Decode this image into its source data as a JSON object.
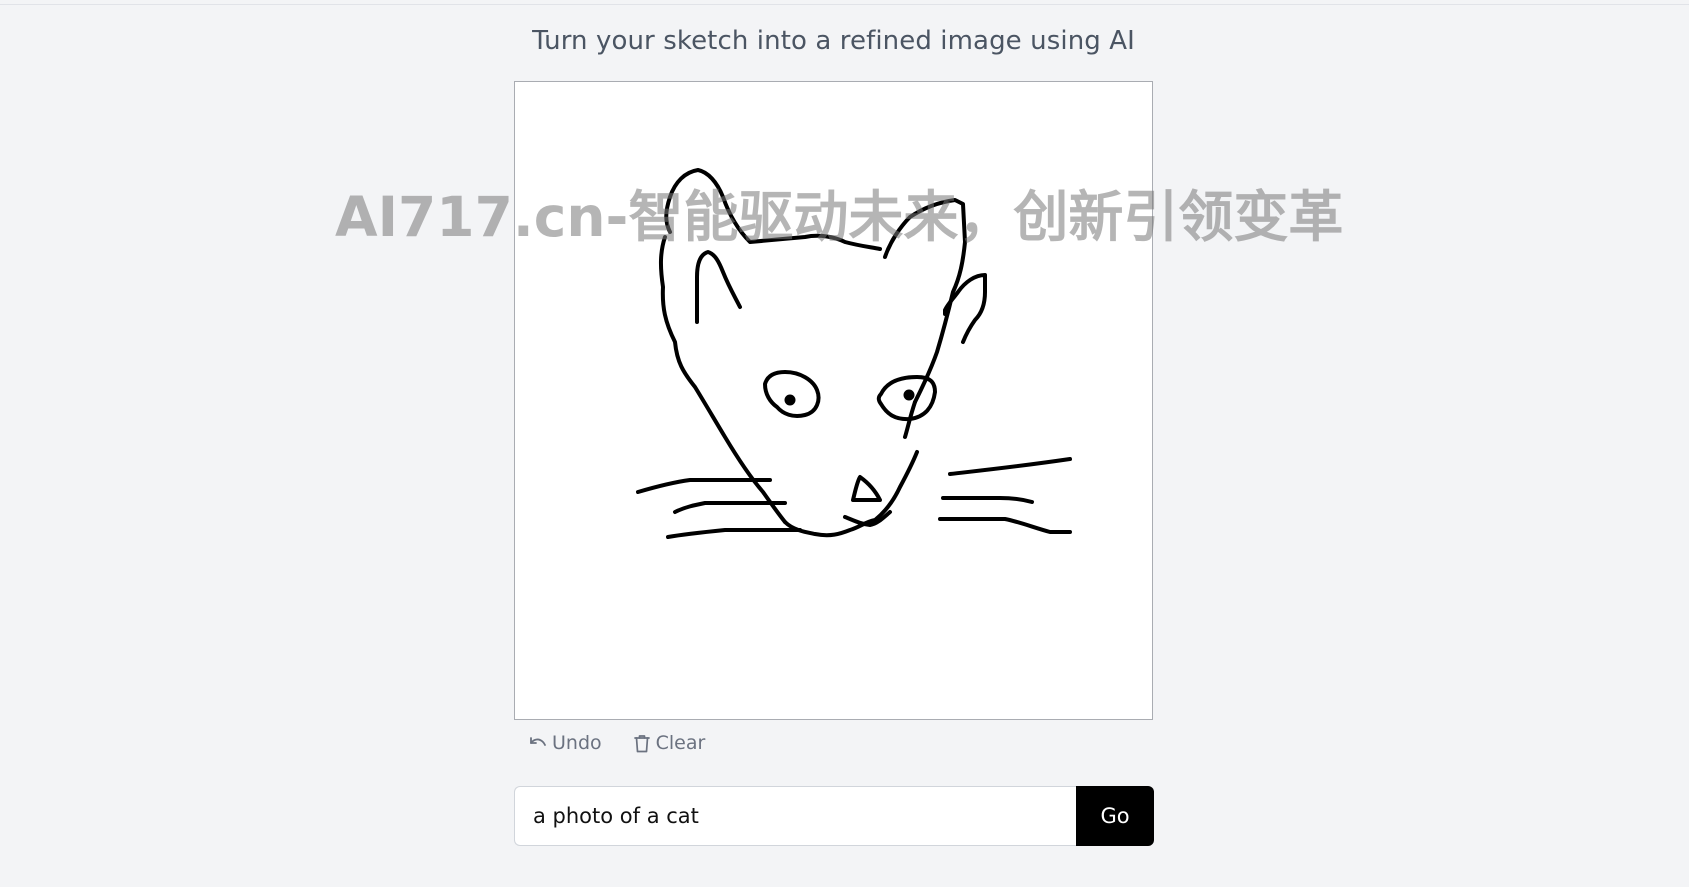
{
  "header": {
    "subtitle": "Turn your sketch into a refined image using AI"
  },
  "watermark": {
    "text": "AI717.cn-智能驱动未来，创新引领变革"
  },
  "canvas": {
    "background": "#ffffff",
    "stroke_color": "#000000",
    "drawing": "cat-face-sketch"
  },
  "toolbar": {
    "undo_label": "Undo",
    "undo_icon": "undo-arrow-icon",
    "clear_label": "Clear",
    "clear_icon": "trash-icon"
  },
  "prompt": {
    "value": "a photo of a cat",
    "placeholder": "",
    "submit_label": "Go"
  },
  "colors": {
    "page_bg": "#f3f4f6",
    "text_muted": "#6b7280",
    "button_bg": "#000000",
    "button_text": "#ffffff"
  }
}
